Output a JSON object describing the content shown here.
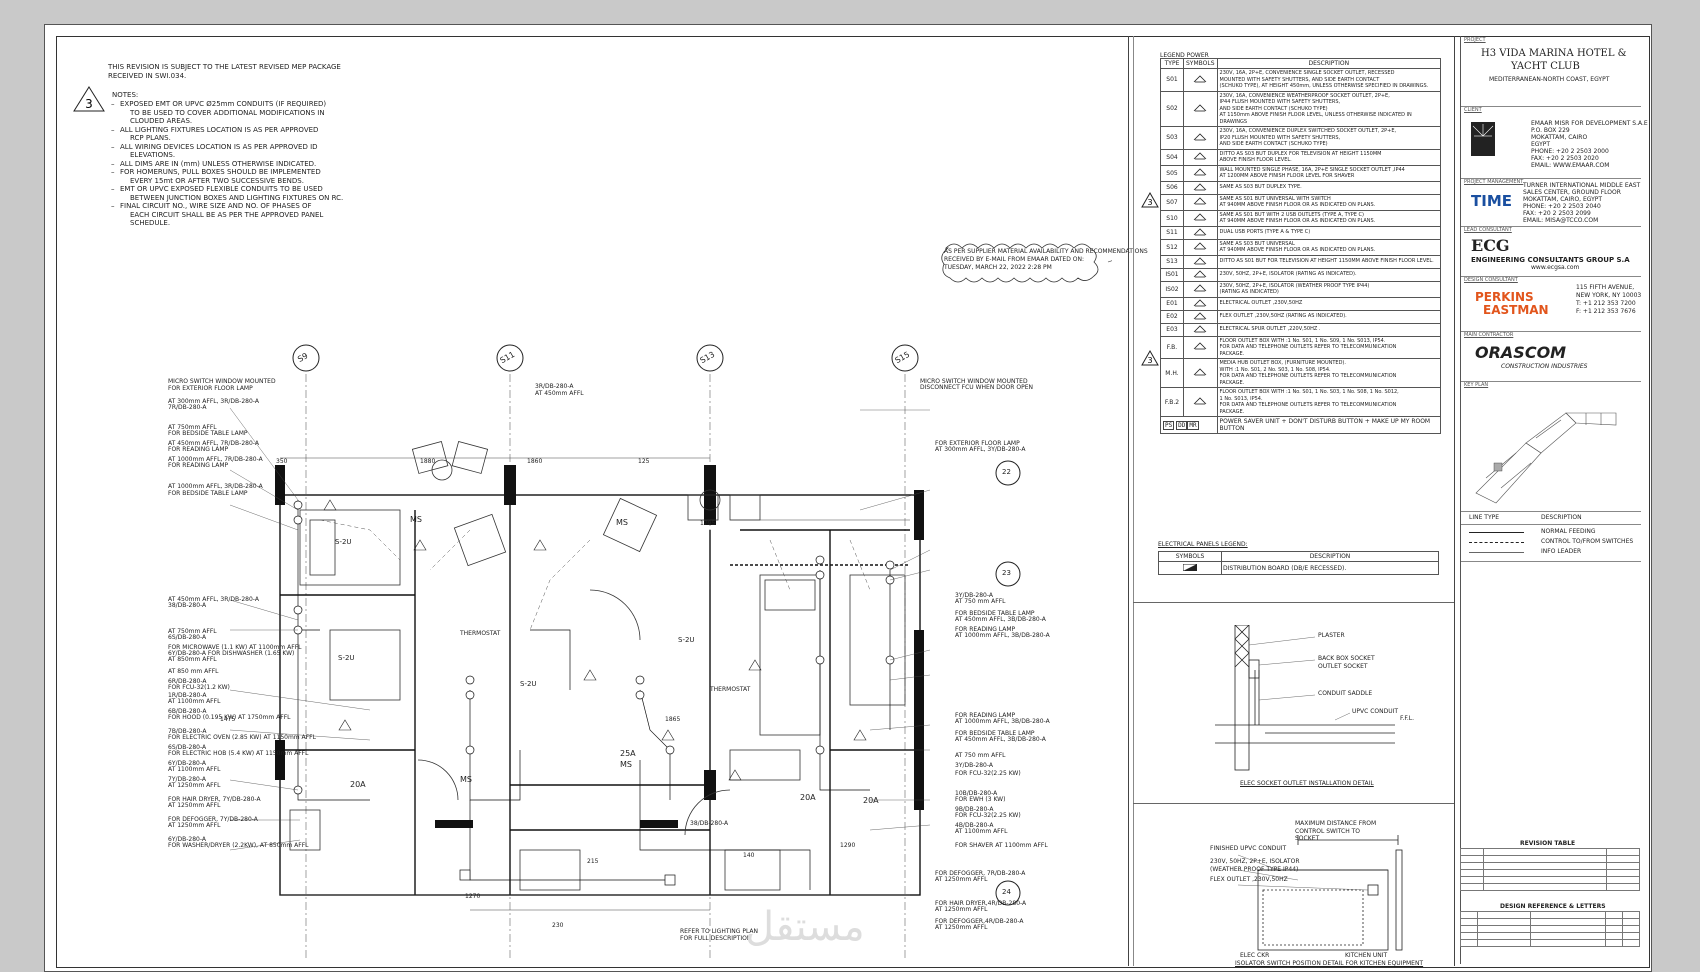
{
  "revision_note": {
    "line1": "THIS REVISION IS SUBJECT TO THE LATEST REVISED MEP PACKAGE",
    "line2": "RECEIVED IN SWI.034.",
    "rev_mark": "3"
  },
  "notes": {
    "title": "NOTES:",
    "items": [
      "EXPOSED EMT OR UPVC Ø25mm CONDUITS (IF REQUIRED)",
      "TO BE USED TO COVER ADDITIONAL MODIFICATIONS IN",
      "CLOUDED AREAS.",
      "ALL LIGHTING FIXTURES LOCATION IS AS PER APPROVED",
      "RCP PLANS.",
      "ALL WIRING DEVICES LOCATION IS AS PER APPROVED ID",
      "ELEVATIONS.",
      "ALL DIMS ARE IN (mm) UNLESS OTHERWISE INDICATED.",
      "FOR HOMERUNS, PULL BOXES SHOULD BE IMPLEMENTED",
      "EVERY 15mt OR AFTER TWO SUCCESSIVE BENDS.",
      "EMT OR UPVC EXPOSED FLEXIBLE CONDUITS TO BE USED",
      "BETWEEN JUNCTION BOXES AND LIGHTING FIXTURES ON RC.",
      "FINAL CIRCUIT NO., WIRE SIZE AND NO. OF PHASES OF",
      "EACH CIRCUIT SHALL BE AS PER THE APPROVED PANEL",
      "SCHEDULE."
    ]
  },
  "cloud_note": [
    "AS PER SUPPLIER MATERIAL AVAILABILITY AND RECOMMENDATIONS",
    "RECEIVED BY E-MAIL FROM EMAAR DATED ON:",
    "TUESDAY, MARCH 22, 2022 2:28 PM"
  ],
  "grid_bubbles": [
    "S9",
    "S11",
    "S13",
    "S15",
    "22",
    "23",
    "24"
  ],
  "plan_labels": {
    "ms": "MS",
    "s2u": "S-2U",
    "thermostat": "THERMOSTAT",
    "panel_25a": "25A",
    "panel_20a": "20A",
    "dims": [
      "350",
      "1880",
      "1860",
      "125",
      "1795",
      "1475",
      "1865",
      "1270",
      "1290",
      "215",
      "230",
      "140"
    ],
    "circuit_1": "3R/DB-280-A",
    "circuit_2": "AT 450mm AFFL",
    "circuit_3": "38/DB-280-A",
    "circuit_4": "FOR EXTERIOR FLOOR LAMP",
    "circuit_5": "AT 300mm AFFL, 3R/DB-280-A",
    "circuit_6": "MICRO SWITCH WINDOW MOUNTED",
    "circuit_7": "DISCONNECT FCU WHEN DOOR OPEN"
  },
  "left_callouts": [
    "MICRO SWITCH WINDOW MOUNTED",
    "FOR EXTERIOR FLOOR LAMP",
    "AT 300mm AFFL, 3R/DB-280-A",
    "7R/DB-280-A",
    "AT 750mm AFFL",
    "FOR BEDSIDE TABLE LAMP",
    "AT 450mm AFFL, 7R/DB-280-A",
    "FOR READING LAMP",
    "AT 1000mm AFFL, 7R/DB-280-A",
    "FOR READING LAMP",
    "AT 1000mm AFFL, 3R/DB-280-A",
    "FOR BEDSIDE TABLE LAMP",
    "AT 450mm AFFL, 3R/DB-280-A",
    "38/DB-280-A",
    "AT 750mm AFFL",
    "6S/DB-280-A",
    "FOR MICROWAVE (1.1 KW) AT 1100mm AFFL",
    "6Y/DB-280-A FOR DISHWASHER (1.65 KW)",
    "AT 850mm AFFL",
    "AT 850 mm AFFL",
    "6R/DB-280-A",
    "FOR FCU-32(1.2 KW)",
    "1R/DB-280-A",
    "AT 1100mm AFFL",
    "6B/DB-280-A",
    "FOR HOOD (0.195 KW) AT 1750mm AFFL",
    "7B/DB-280-A",
    "FOR ELECTRIC OVEN (2.85 KW) AT 1150mm AFFL",
    "6S/DB-280-A",
    "FOR ELECTRIC HOB (5.4 KW) AT 1150mm AFFL",
    "6Y/DB-280-A",
    "AT 1100mm AFFL",
    "7Y/DB-280-A",
    "AT 1250mm AFFL",
    "FOR HAIR DRYER, 7Y/DB-280-A",
    "AT 1250mm AFFL",
    "FOR DEFOGGER, 7Y/DB-280-A",
    "AT 1250mm AFFL",
    "6Y/DB-280-A",
    "FOR WASHER/DRYER (2.2KW), AT 850mm AFFL"
  ],
  "right_callouts": [
    "MICRO SWITCH WINDOW MOUNTED",
    "DISCONNECT FCU WHEN DOOR OPEN",
    "FOR EXTERIOR FLOOR LAMP",
    "AT 300mm AFFL, 3Y/DB-280-A",
    "3Y/DB-280-A",
    "AT 750 mm AFFL",
    "FOR BEDSIDE TABLE LAMP",
    "AT 450mm AFFL, 3B/DB-280-A",
    "FOR READING LAMP",
    "AT 1000mm AFFL, 3B/DB-280-A",
    "FOR READING LAMP",
    "AT 1000mm AFFL, 3B/DB-280-A",
    "FOR BEDSIDE TABLE LAMP",
    "AT 450mm AFFL, 3B/DB-280-A",
    "AT 750 mm AFFL",
    "3Y/DB-280-A",
    "FOR FCU-32(2.25 KW)",
    "10B/DB-280-A",
    "FOR EWH (3 KW)",
    "9B/DB-280-A",
    "FOR FCU-32(2.25 KW)",
    "4B/DB-280-A",
    "AT 1100mm AFFL",
    "FOR SHAVER AT 1100mm AFFL",
    "FOR DEFOGGER, 7R/DB-280-A",
    "AT 1250mm AFFL",
    "FOR HAIR DRYER,4R/DB-280-A",
    "AT 1250mm AFFL",
    "FOR DEFOGGER,4R/DB-280-A",
    "AT 1250mm AFFL"
  ],
  "bottom_note": [
    "REFER TO LIGHTING PLAN",
    "FOR FULL DESCRIPTION"
  ],
  "legend_power": {
    "title": "LEGEND POWER",
    "headers": [
      "TYPE",
      "SYMBOLS",
      "DESCRIPTION"
    ],
    "rows": [
      {
        "type": "S01",
        "desc": [
          "230V, 16A, 2P+E, CONVENIENCE SINGLE SOCKET OUTLET, RECESSED",
          "MOUNTED WITH SAFETY SHUTTERS, AND SIDE EARTH CONTACT",
          "(SCHUKO TYPE), AT HEIGHT 450mm, UNLESS OTHERWISE SPECIFIED IN DRAWINGS."
        ]
      },
      {
        "type": "S02",
        "desc": [
          "230V, 16A, CONVENIENCE WEATHERPROOF SOCKET OUTLET, 2P+E,",
          "IP44 FLUSH MOUNTED WITH SAFETY SHUTTERS,",
          "AND SIDE EARTH CONTACT (SCHUKO TYPE)",
          "AT 1150mm ABOVE FINISH FLOOR LEVEL, UNLESS OTHERWISE INDICATED IN DRAWINGS"
        ]
      },
      {
        "type": "S03",
        "desc": [
          "230V, 16A, CONVENIENCE DUPLEX SWITCHED SOCKET OUTLET, 2P+E,",
          "IP20 FLUSH MOUNTED WITH SAFETY SHUTTERS,",
          "AND SIDE EARTH CONTACT (SCHUKO TYPE)"
        ]
      },
      {
        "type": "S04",
        "desc": [
          "DITTO AS S03 BUT DUPLEX FOR TELEVISION AT HEIGHT 1150MM",
          "ABOVE FINISH FLOOR LEVEL."
        ]
      },
      {
        "type": "S05",
        "desc": [
          "WALL MOUNTED SINGLE PHASE, 16A, 2P+E SINGLE SOCKET OUTLET ,IP44",
          "AT 1200MM ABOVE FINISH FLOOR LEVEL FOR SHAVER"
        ]
      },
      {
        "type": "S06",
        "desc": [
          "SAME AS S03 BUT DUPLEX TYPE."
        ]
      },
      {
        "type": "S07",
        "desc": [
          "SAME AS S01 BUT UNIVERSAL WITH SWITCH",
          "AT 940MM ABOVE FINISH FLOOR OR AS INDICATED ON PLANS."
        ]
      },
      {
        "type": "S10",
        "desc": [
          "SAME AS S01 BUT WITH 2 USB OUTLETS (TYPE A, TYPE C)",
          "AT 940MM ABOVE FINISH FLOOR OR AS INDICATED ON PLANS."
        ]
      },
      {
        "type": "S11",
        "desc": [
          "DUAL USB PORTS (TYPE A & TYPE C)"
        ]
      },
      {
        "type": "S12",
        "desc": [
          "SAME AS S03 BUT UNIVERSAL",
          "AT 940MM ABOVE FINISH FLOOR OR AS INDICATED ON PLANS."
        ]
      },
      {
        "type": "S13",
        "desc": [
          "DITTO AS S01 BUT FOR TELEVISION AT HEIGHT 1150MM ABOVE FINISH FLOOR LEVEL."
        ]
      },
      {
        "type": "IS01",
        "desc": [
          "230V, 50HZ, 2P+E, ISOLATOR (RATING AS INDICATED)."
        ]
      },
      {
        "type": "IS02",
        "desc": [
          "230V, 50HZ, 2P+E, ISOLATOR (WEATHER PROOF TYPE IP44)",
          "(RATING AS INDICATED)"
        ]
      },
      {
        "type": "E01",
        "desc": [
          "ELECTRICAL OUTLET ,230V,50HZ"
        ]
      },
      {
        "type": "E02",
        "desc": [
          "FLEX OUTLET ,230V,50HZ (RATING AS INDICATED)."
        ]
      },
      {
        "type": "E03",
        "desc": [
          "ELECTRICAL SPUR OUTLET ,220V,50HZ ."
        ]
      },
      {
        "type": "F.B.",
        "desc": [
          "FLOOR OUTLET BOX WITH :1 No. S01, 1 No. S09, 1 No. S013, IP54.",
          "FOR DATA AND TELEPHONE OUTLETS REFER TO TELECOMMUNICATION",
          "PACKAGE."
        ]
      },
      {
        "type": "M.H.",
        "desc": [
          "MEDIA HUB OUTLET BOX, (FURNITURE MOUNTED).",
          "WITH :1 No. S01, 2 No. S03, 1 No. S08, IP54.",
          "FOR DATA AND TELEPHONE OUTLETS REFER TO TELECOMMUNICATION",
          "PACKAGE."
        ]
      },
      {
        "type": "F.B.2",
        "desc": [
          "FLOOR OUTLET BOX WITH :1 No. S01, 1 No. S03, 1 No. S08, 1 No. S012,",
          "1 No. S013, IP54.",
          "FOR DATA AND TELEPHONE OUTLETS REFER TO TELECOMMUNICATION",
          "PACKAGE."
        ]
      }
    ],
    "footer_desc": "POWER SAVER UNIT + DON'T DISTURB BUTTON + MAKE UP MY ROOM BUTTON",
    "footer_symbols": [
      "PS",
      "DD",
      "MR"
    ]
  },
  "electrical_panels_legend": {
    "title": "ELECTRICAL PANELS LEGEND:",
    "headers": [
      "SYMBOLS",
      "DESCRIPTION"
    ],
    "row_desc": "DISTRIBUTION BOARD (DB/E RECESSED)."
  },
  "detail1": {
    "labels": [
      "PLASTER",
      "BACK BOX SOCKET OUTLET SOCKET",
      "CONDUIT SADDLE",
      "UPVC CONDUIT",
      "F.F.L."
    ],
    "caption": "ELEC SOCKET OUTLET INSTALLATION DETAIL"
  },
  "detail2": {
    "labels": [
      "MAXIMUM DISTANCE FROM CONTROL SWITCH TO SOCKET",
      "FINISHED UPVC CONDUIT",
      "230V, 50HZ, 2P+E, ISOLATOR (WEATHER PROOF TYPE IP44)",
      "FLEX OUTLET ,230V,50HZ",
      "ELEC CKR",
      "KITCHEN UNIT"
    ],
    "caption": "ISOLATOR SWITCH POSITION DETAIL FOR KITCHEN EQUIPMENT"
  },
  "title_block": {
    "project_label": "PROJECT",
    "project_name_1": "H3 VIDA MARINA HOTEL &",
    "project_name_2": "YACHT CLUB",
    "project_location": "MEDITERRANEAN-NORTH COAST, EGYPT",
    "client_label": "CLIENT",
    "client_lines": [
      "EMAAR MISR FOR DEVELOPMENT S.A.E",
      "P.O. BOX 229",
      "MOKATTAM, CAIRO",
      "EGYPT",
      "PHONE: +20 2 2503 2000",
      "FAX: +20 2 2503 2020",
      "EMAIL: WWW.EMAAR.COM"
    ],
    "pm_label": "PROJECT MANAGEMENT",
    "pm_logo": "TIME",
    "pm_lines": [
      "TURNER INTERNATIONAL MIDDLE EAST",
      "SALES CENTER, GROUND FLOOR",
      "MOKATTAM, CAIRO, EGYPT",
      "PHONE: +20 2 2503 2040",
      "FAX: +20 2 2503 2099",
      "EMAIL: MISA@TCCO.COM"
    ],
    "lead_label": "LEAD CONSULTANT",
    "lead_logo": "ECG",
    "lead_sub": "ENGINEERING CONSULTANTS GROUP S.A",
    "lead_web": "www.ecgsa.com",
    "design_label": "DESIGN CONSULTANT",
    "design_logo_1": "PERKINS",
    "design_logo_2": "EASTMAN",
    "design_lines": [
      "115 FIFTH AVENUE,",
      "NEW YORK, NY 10003",
      "T: +1 212 353 7200",
      "F: +1 212 353 7676"
    ],
    "contractor_label": "MAIN CONTRACTOR",
    "contractor_logo": "ORASCOM",
    "contractor_sub": "CONSTRUCTION INDUSTRIES",
    "keyplan_label": "KEY PLAN",
    "line_type_headers": [
      "LINE TYPE",
      "DESCRIPTION"
    ],
    "line_types": [
      "NORMAL FEEDING",
      "CONTROL TO/FROM SWITCHES",
      "INFO LEADER"
    ],
    "revision_table_title": "REVISION TABLE",
    "design_ref_title": "DESIGN REFERENCE & LETTERS"
  },
  "watermark": "مستقل"
}
